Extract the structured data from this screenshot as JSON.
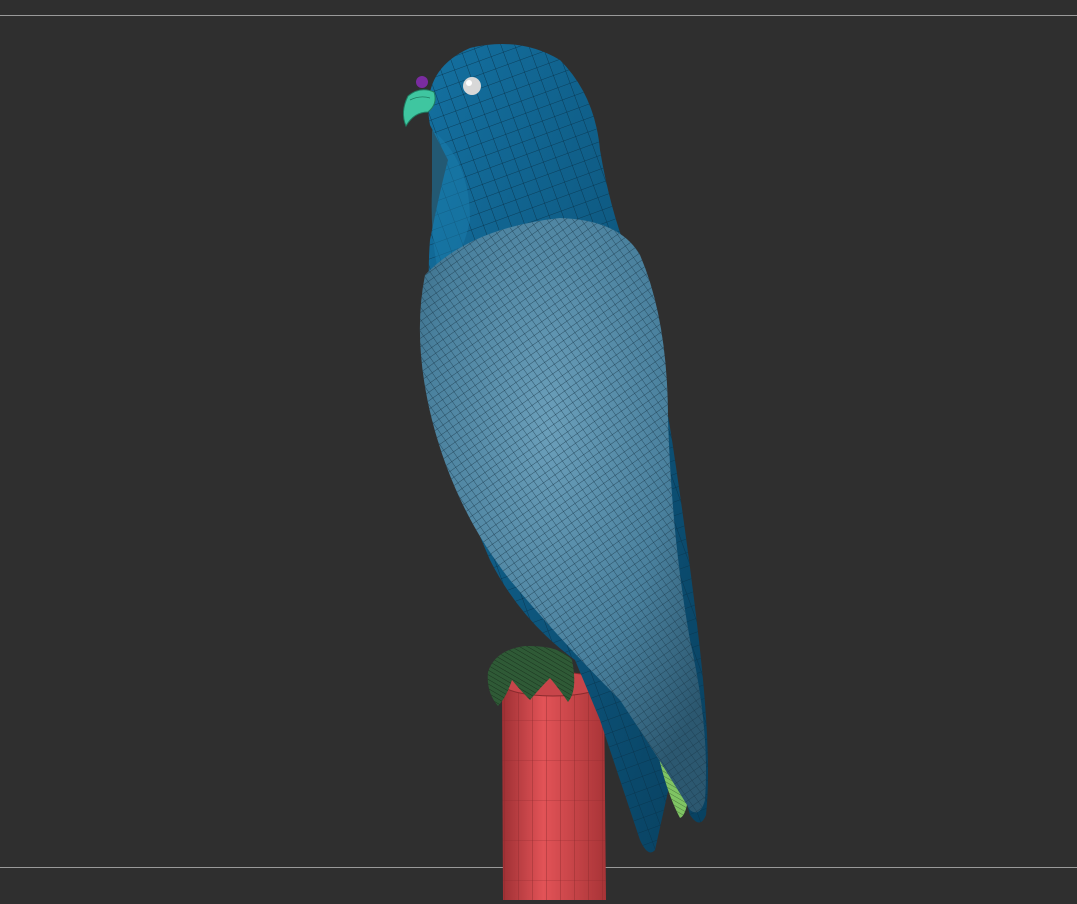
{
  "viewport": {
    "background": "#2f2f2f",
    "frame_line_color": "#9a9a9a"
  },
  "model": {
    "subject": "falcon-mesh-icon",
    "parts": [
      {
        "name": "head-and-back",
        "color": "#0d5a82"
      },
      {
        "name": "wing",
        "color": "#4e89a8"
      },
      {
        "name": "beak",
        "color": "#3fc6a0"
      },
      {
        "name": "eye",
        "color": "#d8d8d8"
      },
      {
        "name": "eye-ring",
        "color": "#7a2ca0"
      },
      {
        "name": "talons",
        "color": "#2f5a36"
      },
      {
        "name": "tail-feathers",
        "color": "#7fc463"
      },
      {
        "name": "perch",
        "color": "#d9494d"
      }
    ],
    "wireframe": true
  }
}
